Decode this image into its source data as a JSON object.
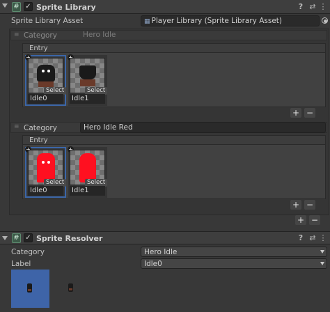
{
  "sprite_library": {
    "title": "Sprite Library",
    "asset_label": "Sprite Library Asset",
    "asset_value": "Player Library (Sprite Library Asset)",
    "asset_icon": "sprite-library-asset-icon",
    "categories": [
      {
        "label": "Category",
        "name": "Hero Idle",
        "entry_header": "Entry",
        "sprites": [
          {
            "name": "Idle0",
            "select_label": "Select",
            "selected": true,
            "color": "#1a1a1a",
            "eyes": "#ffffff"
          },
          {
            "name": "Idle1",
            "select_label": "Select",
            "selected": false,
            "color": "#1a1a1a",
            "eyes": ""
          }
        ]
      },
      {
        "label": "Category",
        "name": "Hero Idle Red",
        "entry_header": "Entry",
        "sprites": [
          {
            "name": "Idle0",
            "select_label": "Select",
            "selected": true,
            "color": "#ff1020",
            "eyes": "#ffffff"
          },
          {
            "name": "Idle1",
            "select_label": "Select",
            "selected": false,
            "color": "#ff1020",
            "eyes": ""
          }
        ]
      }
    ],
    "add_label": "+",
    "remove_label": "−"
  },
  "sprite_resolver": {
    "title": "Sprite Resolver",
    "category_label": "Category",
    "category_value": "Hero Idle",
    "label_label": "Label",
    "label_value": "Idle0",
    "dropdown_icon": "dropdown-triangle-icon"
  },
  "header_icons": {
    "check": "✓",
    "hash": "#",
    "help": "?",
    "presets": "⇄",
    "more": "⋮"
  },
  "colors": {
    "selection_blue": "#3b66a8",
    "preview_bg": "#3e64a8",
    "hero_red": "#ff1020",
    "hero_black": "#1a1a1a"
  }
}
